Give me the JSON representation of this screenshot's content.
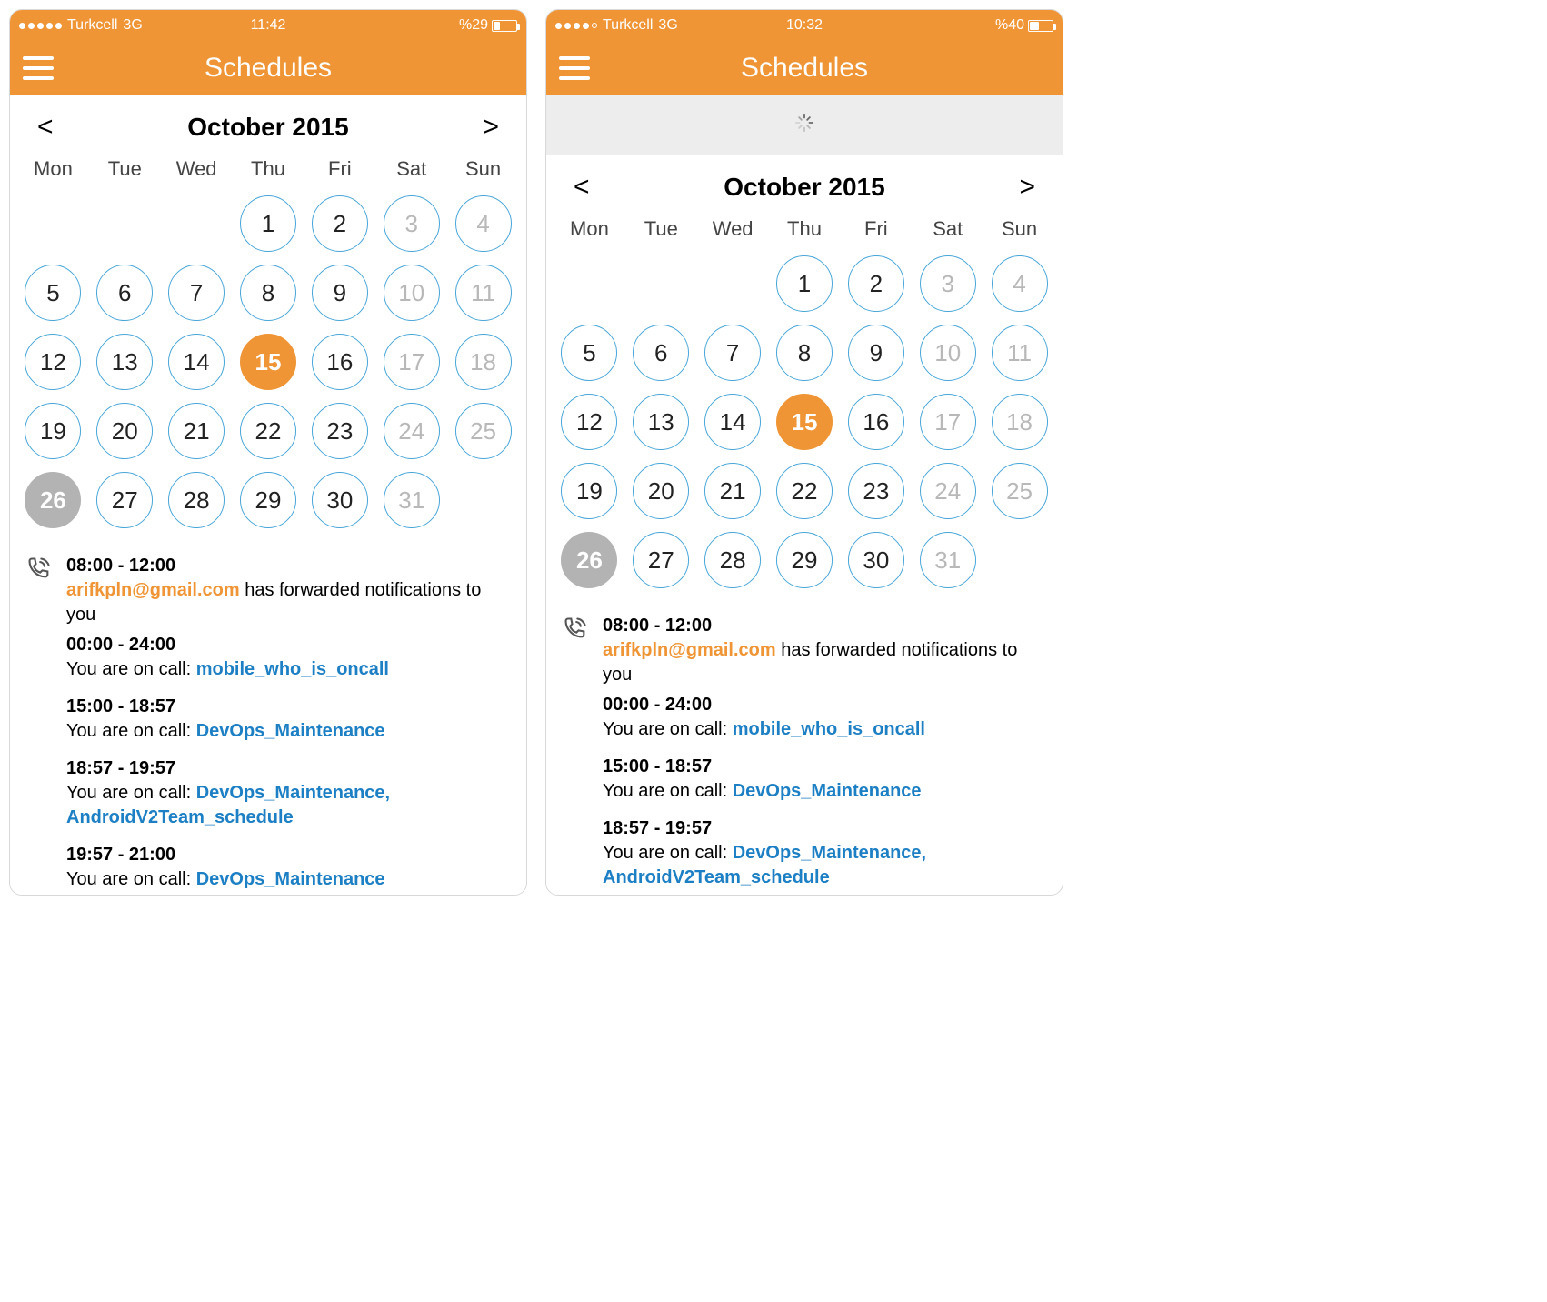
{
  "screens": [
    {
      "status": {
        "carrier": "Turkcell",
        "network": "3G",
        "time": "11:42",
        "battery_text": "%29",
        "battery_pct": 29,
        "signal_style": "full"
      },
      "title": "Schedules",
      "loading": false,
      "month_label": "October 2015",
      "dow": [
        "Mon",
        "Tue",
        "Wed",
        "Thu",
        "Fri",
        "Sat",
        "Sun"
      ],
      "days": [
        {
          "n": "",
          "state": "empty"
        },
        {
          "n": "",
          "state": "empty"
        },
        {
          "n": "",
          "state": "empty"
        },
        {
          "n": "1",
          "state": "normal"
        },
        {
          "n": "2",
          "state": "normal"
        },
        {
          "n": "3",
          "state": "dim"
        },
        {
          "n": "4",
          "state": "dim"
        },
        {
          "n": "5",
          "state": "normal"
        },
        {
          "n": "6",
          "state": "normal"
        },
        {
          "n": "7",
          "state": "normal"
        },
        {
          "n": "8",
          "state": "normal"
        },
        {
          "n": "9",
          "state": "normal"
        },
        {
          "n": "10",
          "state": "dim"
        },
        {
          "n": "11",
          "state": "dim"
        },
        {
          "n": "12",
          "state": "normal"
        },
        {
          "n": "13",
          "state": "normal"
        },
        {
          "n": "14",
          "state": "normal"
        },
        {
          "n": "15",
          "state": "selected"
        },
        {
          "n": "16",
          "state": "normal"
        },
        {
          "n": "17",
          "state": "dim"
        },
        {
          "n": "18",
          "state": "dim"
        },
        {
          "n": "19",
          "state": "normal"
        },
        {
          "n": "20",
          "state": "normal"
        },
        {
          "n": "21",
          "state": "normal"
        },
        {
          "n": "22",
          "state": "normal"
        },
        {
          "n": "23",
          "state": "normal"
        },
        {
          "n": "24",
          "state": "dim"
        },
        {
          "n": "25",
          "state": "dim"
        },
        {
          "n": "26",
          "state": "today-grey"
        },
        {
          "n": "27",
          "state": "normal"
        },
        {
          "n": "28",
          "state": "normal"
        },
        {
          "n": "29",
          "state": "normal"
        },
        {
          "n": "30",
          "state": "normal"
        },
        {
          "n": "31",
          "state": "dim"
        }
      ],
      "events": [
        {
          "time": "08:00 - 12:00",
          "lead": true,
          "email": "arifkpln@gmail.com",
          "text_after": " has forwarded notifications to you"
        },
        {
          "time": "00:00 - 24:00",
          "prefix": "You are on call: ",
          "links": [
            "mobile_who_is_oncall"
          ]
        },
        {
          "time": "15:00 - 18:57",
          "prefix": "You are on call: ",
          "links": [
            "DevOps_Maintenance"
          ]
        },
        {
          "time": "18:57 - 19:57",
          "prefix": "You are on call: ",
          "links": [
            "DevOps_Maintenance, AndroidV2Team_schedule"
          ]
        },
        {
          "time": "19:57 - 21:00",
          "prefix": "You are on call: ",
          "links": [
            "DevOps_Maintenance"
          ]
        }
      ]
    },
    {
      "status": {
        "carrier": "Turkcell",
        "network": "3G",
        "time": "10:32",
        "battery_text": "%40",
        "battery_pct": 40,
        "signal_style": "partial"
      },
      "title": "Schedules",
      "loading": true,
      "month_label": "October 2015",
      "dow": [
        "Mon",
        "Tue",
        "Wed",
        "Thu",
        "Fri",
        "Sat",
        "Sun"
      ],
      "days": [
        {
          "n": "",
          "state": "empty"
        },
        {
          "n": "",
          "state": "empty"
        },
        {
          "n": "",
          "state": "empty"
        },
        {
          "n": "1",
          "state": "normal"
        },
        {
          "n": "2",
          "state": "normal"
        },
        {
          "n": "3",
          "state": "dim"
        },
        {
          "n": "4",
          "state": "dim"
        },
        {
          "n": "5",
          "state": "normal"
        },
        {
          "n": "6",
          "state": "normal"
        },
        {
          "n": "7",
          "state": "normal"
        },
        {
          "n": "8",
          "state": "normal"
        },
        {
          "n": "9",
          "state": "normal"
        },
        {
          "n": "10",
          "state": "dim"
        },
        {
          "n": "11",
          "state": "dim"
        },
        {
          "n": "12",
          "state": "normal"
        },
        {
          "n": "13",
          "state": "normal"
        },
        {
          "n": "14",
          "state": "normal"
        },
        {
          "n": "15",
          "state": "selected"
        },
        {
          "n": "16",
          "state": "normal"
        },
        {
          "n": "17",
          "state": "dim"
        },
        {
          "n": "18",
          "state": "dim"
        },
        {
          "n": "19",
          "state": "normal"
        },
        {
          "n": "20",
          "state": "normal"
        },
        {
          "n": "21",
          "state": "normal"
        },
        {
          "n": "22",
          "state": "normal"
        },
        {
          "n": "23",
          "state": "normal"
        },
        {
          "n": "24",
          "state": "dim"
        },
        {
          "n": "25",
          "state": "dim"
        },
        {
          "n": "26",
          "state": "today-grey"
        },
        {
          "n": "27",
          "state": "normal"
        },
        {
          "n": "28",
          "state": "normal"
        },
        {
          "n": "29",
          "state": "normal"
        },
        {
          "n": "30",
          "state": "normal"
        },
        {
          "n": "31",
          "state": "dim"
        }
      ],
      "events": [
        {
          "time": "08:00 - 12:00",
          "lead": true,
          "email": "arifkpln@gmail.com",
          "text_after": " has forwarded notifications to you"
        },
        {
          "time": "00:00 - 24:00",
          "prefix": "You are on call: ",
          "links": [
            "mobile_who_is_oncall"
          ]
        },
        {
          "time": "15:00 - 18:57",
          "prefix": "You are on call: ",
          "links": [
            "DevOps_Maintenance"
          ]
        },
        {
          "time": "18:57 - 19:57",
          "prefix": "You are on call: ",
          "links": [
            "DevOps_Maintenance, AndroidV2Team_schedule"
          ]
        }
      ]
    }
  ]
}
